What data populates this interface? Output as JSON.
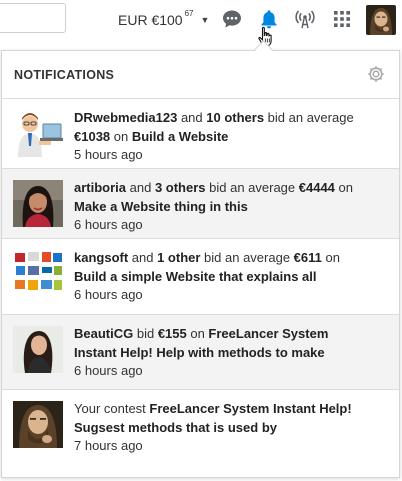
{
  "topbar": {
    "currency_label": "EUR €100",
    "currency_superscript": "67",
    "icons": [
      "chat-icon",
      "bell-icon",
      "signal-icon",
      "grid-icon"
    ],
    "accent_color": "#0087e0"
  },
  "notifications": {
    "title": "NOTIFICATIONS",
    "items": [
      {
        "user": "DRwebmedia123",
        "t1": " and ",
        "others": "10 others",
        "t2": " bid an average ",
        "amount": "€1038",
        "t3": " on ",
        "project": "Build a Website",
        "time": "5 hours ago"
      },
      {
        "user": "artiboria",
        "t1": " and ",
        "others": "3 others",
        "t2": " bid an average ",
        "amount": "€4444",
        "t3": " on ",
        "project": "Make a Website thing in this",
        "time": "6 hours ago"
      },
      {
        "user": "kangsoft",
        "t1": " and ",
        "others": "1 other",
        "t2": " bid an average ",
        "amount": "€611",
        "t3": " on ",
        "project": "Build a simple Website that explains all",
        "time": "6 hours ago"
      },
      {
        "user": "BeautiCG",
        "t1": " bid ",
        "amount": "€155",
        "t2": " on ",
        "project": "FreeLancer System Instant Help! Help with methods to make",
        "time": "6 hours ago"
      },
      {
        "prefix": "Your contest ",
        "project": "FreeLancer System Instant Help! Sugsest methods that is used by",
        "time": "7 hours ago"
      }
    ]
  }
}
